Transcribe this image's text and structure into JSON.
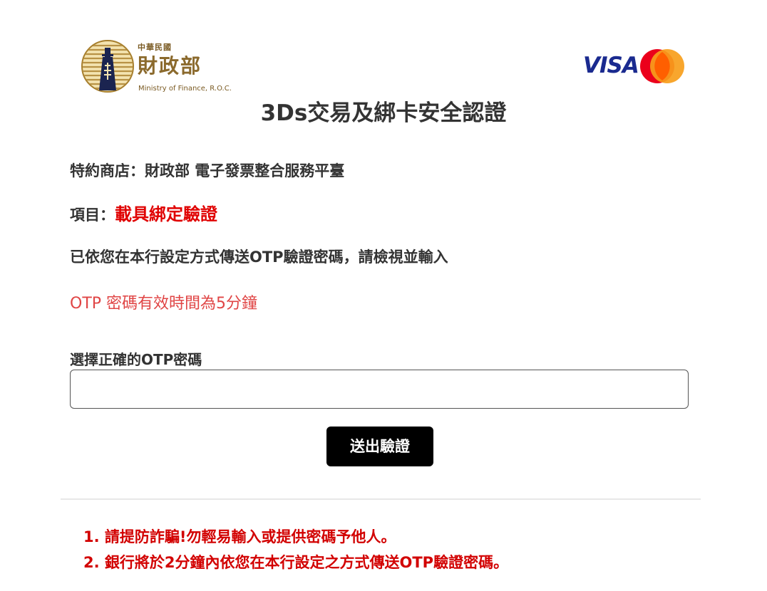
{
  "header": {
    "logo_small": "中華民國",
    "logo_name": "財政部",
    "logo_english": "Ministry of Finance, R.O.C.",
    "visa_label": "VISA",
    "mastercard_icon": "mastercard-logo",
    "page_title": "3Ds交易及綁卡安全認證"
  },
  "merchant": {
    "label": "特約商店：",
    "value": "財政部 電子發票整合服務平臺"
  },
  "item": {
    "label": "項目：",
    "value": "載具綁定驗證"
  },
  "otp_sent_message": "已依您在本行設定方式傳送OTP驗證密碼，請檢視並輸入",
  "otp_valid_message": "OTP 密碼有效時間為5分鐘",
  "form": {
    "otp_label": "選擇正確的OTP密碼",
    "otp_value": "",
    "submit_label": "送出驗證"
  },
  "notes": [
    "1. 請提防詐騙!勿輕易輸入或提供密碼予他人。",
    "2. 銀行將於2分鐘內依您在本行設定之方式傳送OTP驗證密碼。"
  ],
  "colors": {
    "accent_red": "#e00000",
    "notice_red": "#d20000",
    "otp_red": "#e04545",
    "visa_blue": "#1a2a8f",
    "mastercard_red": "#eb001b",
    "mastercard_orange": "#f79e1b",
    "gold": "#8b6a2d"
  }
}
